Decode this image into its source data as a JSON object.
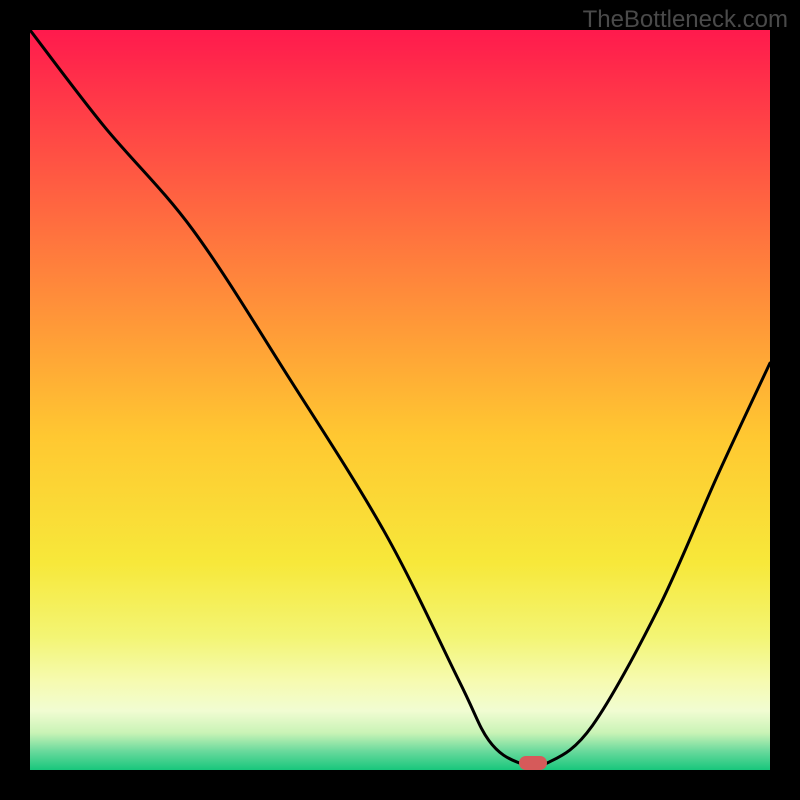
{
  "watermark": "TheBottleneck.com",
  "chart_data": {
    "type": "line",
    "title": "",
    "xlabel": "",
    "ylabel": "",
    "x": [
      0.0,
      0.1,
      0.22,
      0.35,
      0.48,
      0.58,
      0.62,
      0.66,
      0.7,
      0.76,
      0.85,
      0.93,
      1.0
    ],
    "values": [
      1.0,
      0.87,
      0.73,
      0.53,
      0.32,
      0.12,
      0.04,
      0.01,
      0.01,
      0.06,
      0.22,
      0.4,
      0.55
    ],
    "xlim": [
      0,
      1
    ],
    "ylim": [
      0,
      1
    ],
    "marker_x_fraction": 0.68,
    "marker_y_fraction": 0.99,
    "gradient_stops": [
      {
        "pos": 0.0,
        "color": "#ff1a4d"
      },
      {
        "pos": 0.3,
        "color": "#ff7a3d"
      },
      {
        "pos": 0.55,
        "color": "#ffc831"
      },
      {
        "pos": 0.72,
        "color": "#f7e83a"
      },
      {
        "pos": 0.82,
        "color": "#f3f574"
      },
      {
        "pos": 0.88,
        "color": "#f6fbb0"
      },
      {
        "pos": 0.92,
        "color": "#f1fcd2"
      },
      {
        "pos": 0.95,
        "color": "#c9f3b6"
      },
      {
        "pos": 0.975,
        "color": "#68d99c"
      },
      {
        "pos": 1.0,
        "color": "#18c77c"
      }
    ]
  }
}
